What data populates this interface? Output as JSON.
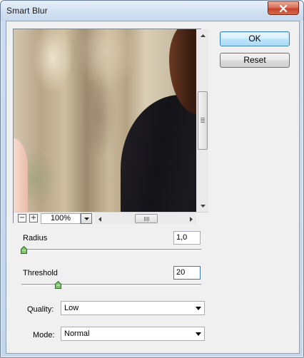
{
  "window": {
    "title": "Smart Blur"
  },
  "preview": {
    "zoom_level": "100%",
    "zoom_out_symbol": "−",
    "zoom_in_symbol": "+"
  },
  "buttons": {
    "ok_label": "OK",
    "reset_label": "Reset"
  },
  "params": {
    "radius": {
      "label": "Radius",
      "value": "1,0"
    },
    "threshold": {
      "label": "Threshold",
      "value": "20"
    },
    "quality": {
      "label": "Quality:",
      "selected": "Low"
    },
    "mode": {
      "label": "Mode:",
      "selected": "Normal"
    }
  },
  "colors": {
    "title_bar": "#d4e3f3",
    "close_button": "#c7452a",
    "dialog_bg": "#f0f0f0",
    "default_button_border": "#3c7fb1",
    "slider_thumb": "#4f9a3c"
  },
  "icons": [
    "close-icon",
    "arrow-up-icon",
    "arrow-down-icon",
    "arrow-left-icon",
    "arrow-right-icon",
    "chevron-down-icon"
  ]
}
